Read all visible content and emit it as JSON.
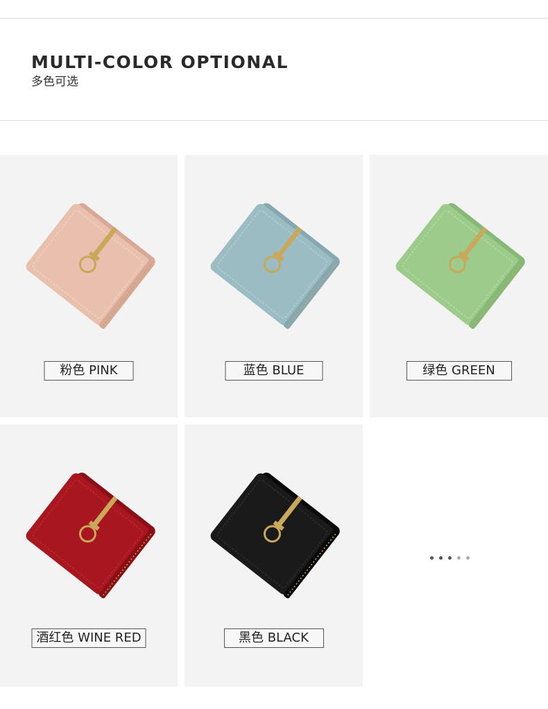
{
  "header": {
    "title": "MULTI-COLOR OPTIONAL",
    "subtitle": "多色可选"
  },
  "products": [
    {
      "label": "粉色 PINK",
      "color": "#e9bfad",
      "dark": "#d8a896",
      "light": "#f3d2c4"
    },
    {
      "label": "蓝色 BLUE",
      "color": "#9cbcc3",
      "dark": "#87a8b0",
      "light": "#b3ced4"
    },
    {
      "label": "绿色 GREEN",
      "color": "#9ccb8c",
      "dark": "#86b877",
      "light": "#b4dca5"
    },
    {
      "label": "酒红色 WINE RED",
      "color": "#a8161f",
      "dark": "#8a0f17",
      "light": "#c02630"
    },
    {
      "label": "黑色 BLACK",
      "color": "#1a1a1a",
      "dark": "#0a0a0a",
      "light": "#2e2e2e"
    }
  ],
  "pager": {
    "dots": 5
  },
  "colors": {
    "panel_bg": "#f3f3f3",
    "hardware_gold": "#c9a85a"
  }
}
